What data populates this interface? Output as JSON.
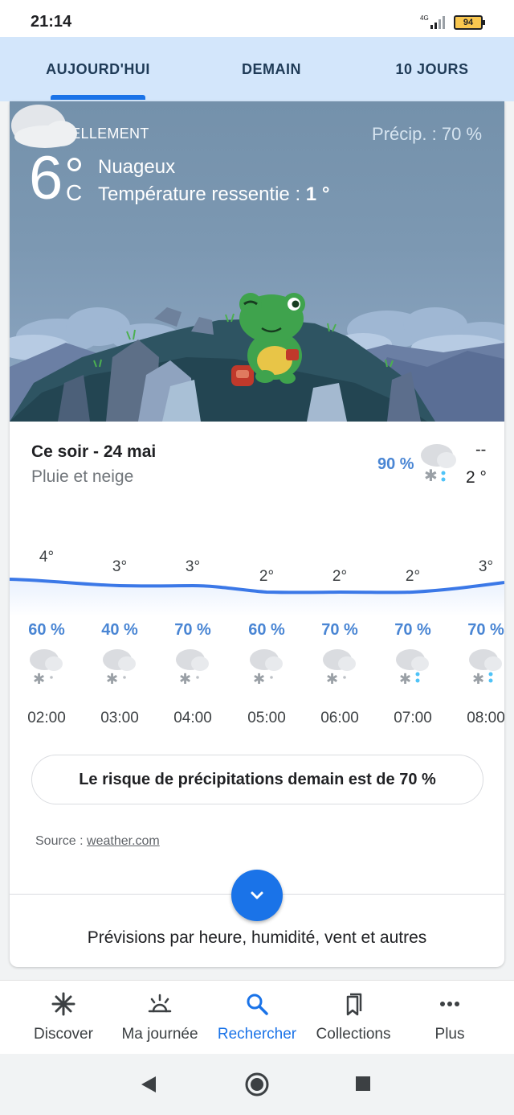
{
  "status": {
    "time": "21:14",
    "network": "4G",
    "battery": "94"
  },
  "tabs": [
    {
      "label": "AUJOURD'HUI",
      "active": true
    },
    {
      "label": "DEMAIN",
      "active": false
    },
    {
      "label": "10 JOURS",
      "active": false
    }
  ],
  "current": {
    "label": "ACTUELLEMENT",
    "precip": "Précip. : 70 %",
    "temp": "6",
    "unit": "C",
    "condition": "Nuageux",
    "feels_prefix": "Température ressentie : ",
    "feels_value": "1 °",
    "icon": "cloud-icon"
  },
  "tonight": {
    "title": "Ce soir - 24 mai",
    "description": "Pluie et neige",
    "precip": "90 %",
    "high": "--",
    "low": "2 °",
    "icon": "rain-snow-icon"
  },
  "hourly": [
    {
      "time": "02:00",
      "temp": "4°",
      "precip": "60 %",
      "icon": "snow-cloud-icon"
    },
    {
      "time": "03:00",
      "temp": "3°",
      "precip": "40 %",
      "icon": "snow-cloud-icon"
    },
    {
      "time": "04:00",
      "temp": "3°",
      "precip": "70 %",
      "icon": "snow-cloud-icon"
    },
    {
      "time": "05:00",
      "temp": "2°",
      "precip": "60 %",
      "icon": "snow-cloud-icon"
    },
    {
      "time": "06:00",
      "temp": "2°",
      "precip": "70 %",
      "icon": "snow-cloud-icon"
    },
    {
      "time": "07:00",
      "temp": "2°",
      "precip": "70 %",
      "icon": "rain-snow-icon"
    },
    {
      "time": "08:00",
      "temp": "3°",
      "precip": "70 %",
      "icon": "rain-snow-icon"
    }
  ],
  "chance_text": "Le risque de précipitations demain est de 70 %",
  "source_prefix": "Source : ",
  "source_link": "weather.com",
  "more_text": "Prévisions par heure, humidité, vent et autres",
  "bottom_nav": [
    {
      "label": "Discover",
      "icon": "discover-icon",
      "active": false
    },
    {
      "label": "Ma journée",
      "icon": "sunrise-icon",
      "active": false
    },
    {
      "label": "Rechercher",
      "icon": "search-icon",
      "active": true
    },
    {
      "label": "Collections",
      "icon": "bookmarks-icon",
      "active": false
    },
    {
      "label": "Plus",
      "icon": "more-icon",
      "active": false
    }
  ],
  "colors": {
    "accent": "#1a73e8",
    "tab_bg": "#d3e6fb",
    "precip_blue": "#4a86d4",
    "scene_sky": "#7491ab"
  }
}
